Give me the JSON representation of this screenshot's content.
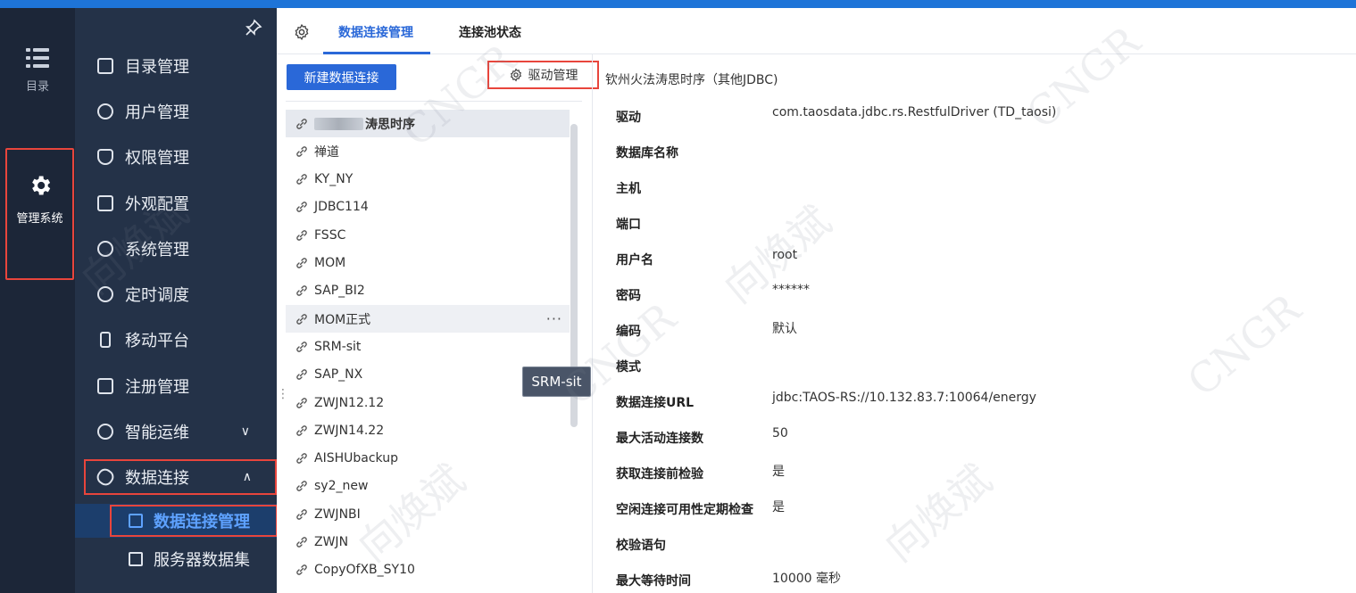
{
  "rail": {
    "catalog_label": "目录",
    "admin_label": "管理系统"
  },
  "nav": {
    "items": [
      {
        "label": "目录管理",
        "icon": "list-icon"
      },
      {
        "label": "用户管理",
        "icon": "user-icon"
      },
      {
        "label": "权限管理",
        "icon": "shield-icon"
      },
      {
        "label": "外观配置",
        "icon": "paint-roller-icon"
      },
      {
        "label": "系统管理",
        "icon": "gear-icon"
      },
      {
        "label": "定时调度",
        "icon": "timer-icon"
      },
      {
        "label": "移动平台",
        "icon": "phone-icon"
      },
      {
        "label": "注册管理",
        "icon": "register-icon"
      },
      {
        "label": "智能运维",
        "icon": "ops-icon"
      },
      {
        "label": "数据连接",
        "icon": "paperclip-icon"
      }
    ],
    "sub_items": [
      {
        "label": "数据连接管理",
        "icon": "database-icon"
      },
      {
        "label": "服务器数据集",
        "icon": "server-dataset-icon"
      }
    ]
  },
  "tabs": {
    "data_connection": "数据连接管理",
    "pool_status": "连接池状态"
  },
  "toolbar": {
    "new_connection": "新建数据连接",
    "driver_manage": "驱动管理",
    "current_connection": "钦州火法涛思时序（其他JDBC)"
  },
  "connections": [
    {
      "label": "涛思时序",
      "blurred_prefix": true,
      "selected": true
    },
    {
      "label": "禅道"
    },
    {
      "label": "KY_NY"
    },
    {
      "label": "JDBC114"
    },
    {
      "label": "FSSC"
    },
    {
      "label": "MOM"
    },
    {
      "label": "SAP_BI2"
    },
    {
      "label": "MOM正式",
      "hover": true
    },
    {
      "label": "SRM-sit"
    },
    {
      "label": "SAP_NX"
    },
    {
      "label": "ZWJN12.12"
    },
    {
      "label": "ZWJN14.22"
    },
    {
      "label": "AISHUbackup"
    },
    {
      "label": "sy2_new"
    },
    {
      "label": "ZWJNBI"
    },
    {
      "label": "ZWJN"
    },
    {
      "label": "CopyOfXB_SY10"
    }
  ],
  "more_icon_text": "···",
  "tooltip": "SRM-sit",
  "details": [
    {
      "key": "驱动",
      "value": "com.taosdata.jdbc.rs.RestfulDriver (TD_taosi)"
    },
    {
      "key": "数据库名称",
      "value": ""
    },
    {
      "key": "主机",
      "value": ""
    },
    {
      "key": "端口",
      "value": ""
    },
    {
      "key": "用户名",
      "value": "root"
    },
    {
      "key": "密码",
      "value": "******"
    },
    {
      "key": "编码",
      "value": "默认"
    },
    {
      "key": "模式",
      "value": ""
    },
    {
      "key": "数据连接URL",
      "value": "jdbc:TAOS-RS://10.132.83.7:10064/energy"
    },
    {
      "key": "最大活动连接数",
      "value": "50"
    },
    {
      "key": "获取连接前检验",
      "value": "是"
    },
    {
      "key": "空闲连接可用性定期检查",
      "value": "是"
    },
    {
      "key": "校验语句",
      "value": ""
    },
    {
      "key": "最大等待时间",
      "value": "10000 毫秒"
    }
  ],
  "watermarks": [
    "CNGR",
    "向焕斌"
  ],
  "colors": {
    "accent": "#2a68d8",
    "highlight_box": "#e8453c",
    "nav_bg": "#243248",
    "rail_bg": "#1c2638"
  }
}
